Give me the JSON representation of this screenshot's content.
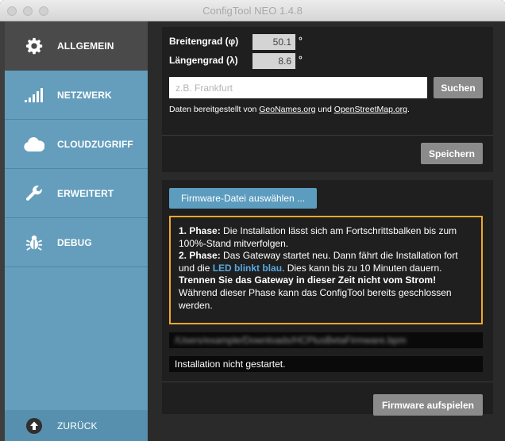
{
  "window": {
    "title": "ConfigTool NEO 1.4.8"
  },
  "sidebar": {
    "items": [
      {
        "label": "ALLGEMEIN",
        "icon": "gear-icon",
        "active": true
      },
      {
        "label": "NETZWERK",
        "icon": "signal-bars-icon",
        "active": false
      },
      {
        "label": "CLOUDZUGRIFF",
        "icon": "cloud-icon",
        "active": false
      },
      {
        "label": "ERWEITERT",
        "icon": "wrench-icon",
        "active": false
      },
      {
        "label": "DEBUG",
        "icon": "bug-icon",
        "active": false
      }
    ],
    "back": {
      "label": "ZURÜCK",
      "icon": "arrow-up-circle-icon"
    }
  },
  "location": {
    "latitude_label": "Breitengrad (φ)",
    "latitude_value": "50.1",
    "longitude_label": "Längengrad (λ)",
    "longitude_value": "8.6",
    "degree_symbol": "°",
    "search_placeholder": "z.B. Frankfurt",
    "search_value": "",
    "search_button": "Suchen",
    "credits_prefix": "Daten bereitgestellt von ",
    "credits_link1": "GeoNames.org",
    "credits_mid": " und ",
    "credits_link2": "OpenStreetMap.org",
    "credits_suffix": ".",
    "save_button": "Speichern"
  },
  "firmware": {
    "select_button": "Firmware-Datei auswählen ...",
    "phase1_title": "1. Phase:",
    "phase1_text": " Die Installation lässt sich am Fortschrittsbalken bis zum 100%-Stand mitverfolgen.",
    "phase2_title": "2. Phase:",
    "phase2_text1": " Das Gateway startet neu. Dann fährt die Installation fort und die ",
    "phase2_led": "LED blinkt blau",
    "phase2_text2": ". Dies kann bis zu 10 Minuten dauern. ",
    "phase2_warning": "Trennen Sie das Gateway in dieser Zeit nicht vom Strom!",
    "phase2_text3": " Während dieser Phase kann das ConfigTool bereits geschlossen werden.",
    "file_path": "/Users/example/Downloads/HCPlusBetaFirmware.bpm",
    "status": "Installation nicht gestartet.",
    "install_button": "Firmware aufspielen"
  },
  "colors": {
    "sidebar": "#649ebc",
    "active_item": "#4a4a4a",
    "accent_blue": "#5c9cbf",
    "warning_border": "#f0a82a",
    "led_text": "#58a9e2"
  }
}
